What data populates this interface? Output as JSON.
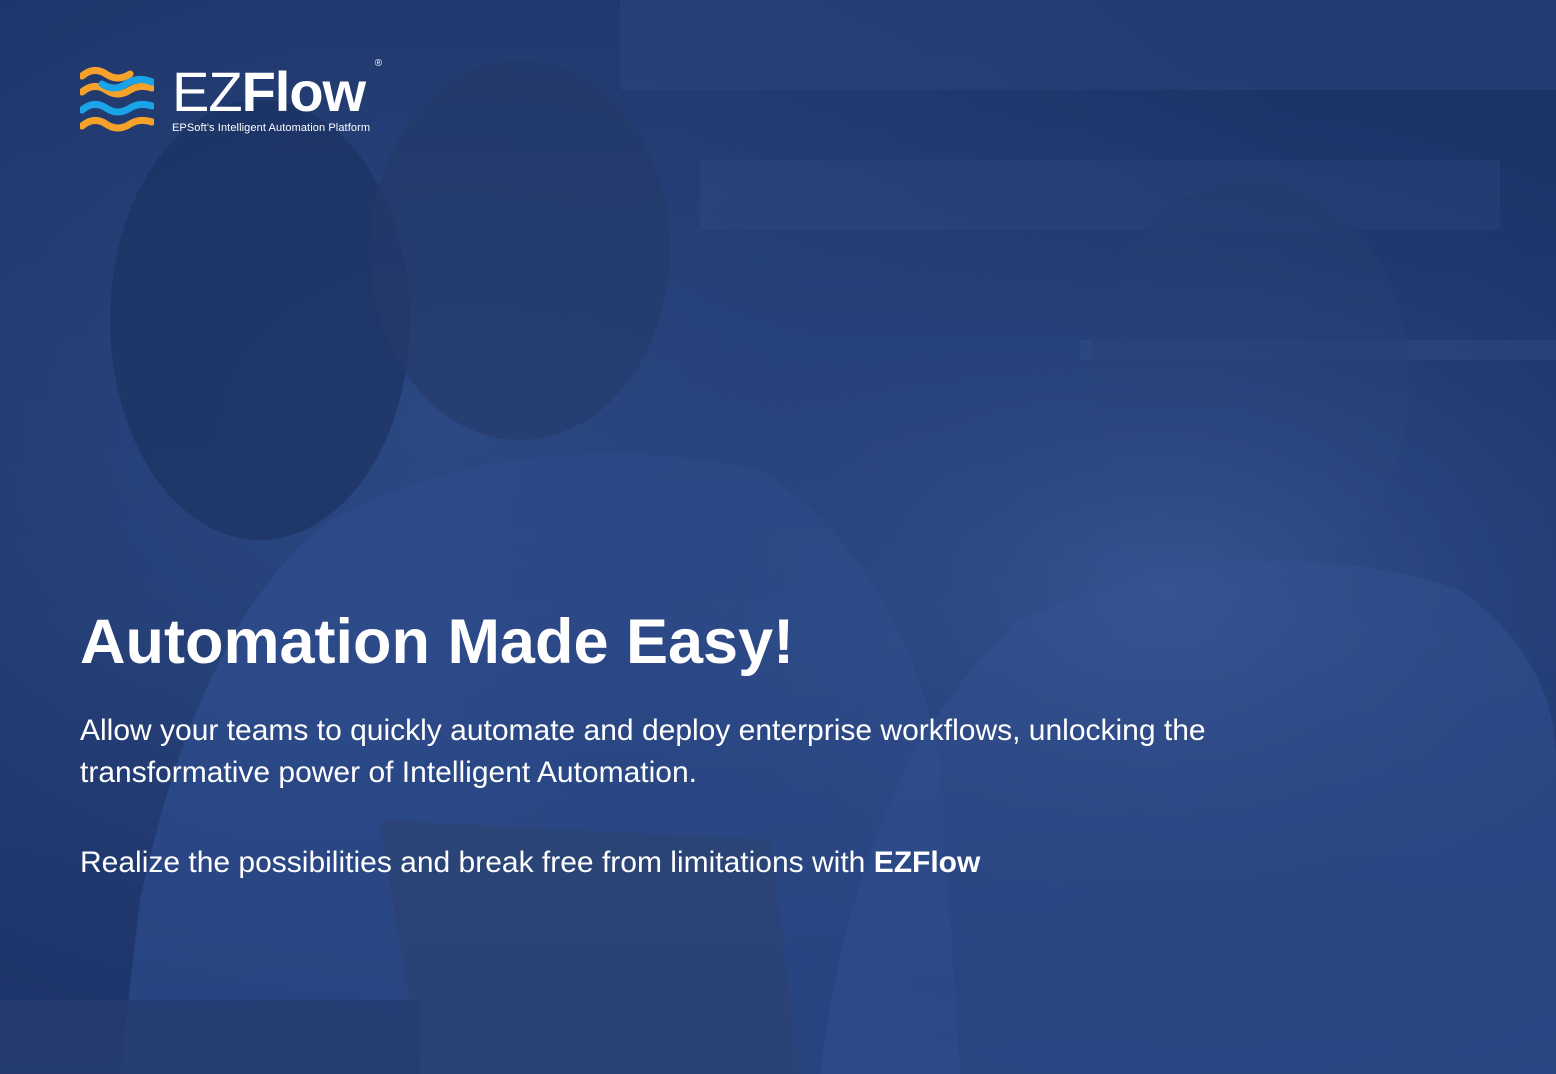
{
  "brand": {
    "name_prefix": "EZ",
    "name_suffix": "Flow",
    "registered_mark": "®",
    "tagline": "EPSoft's Intelligent Automation Platform",
    "logo_colors": {
      "orange": "#f5a12a",
      "blue": "#1ba3e8"
    }
  },
  "hero": {
    "headline": "Automation Made Easy!",
    "description": "Allow your teams to quickly automate and deploy enterprise workflows, unlocking the transformative power of Intelligent Automation.",
    "cta_text": "Realize the possibilities and break free from limitations with ",
    "cta_brand": "EZFlow",
    "background": "photo of two smiling professionals working on laptops in an office, blue tinted overlay",
    "overlay_color": "#1f3a70"
  }
}
